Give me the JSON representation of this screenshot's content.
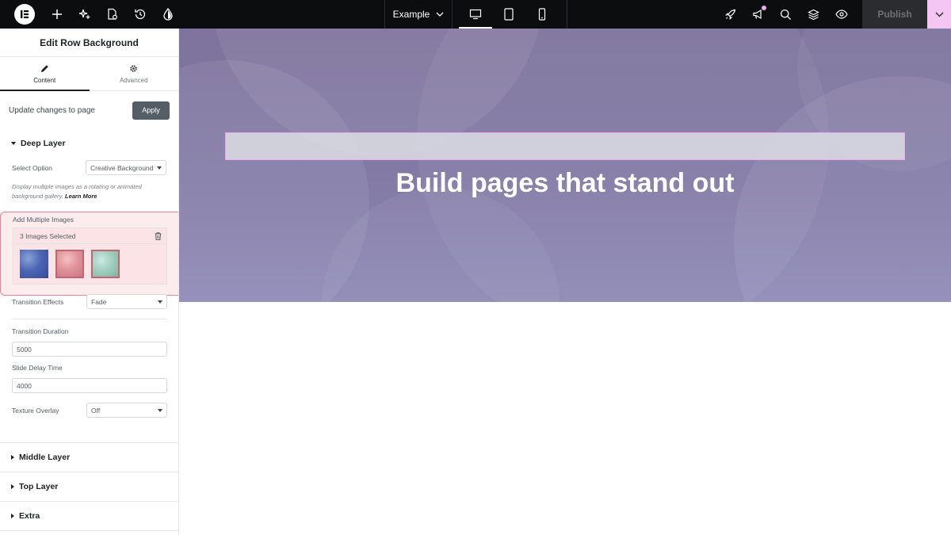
{
  "topbar": {
    "document_name": "Example",
    "publish_label": "Publish",
    "icons_left": [
      "elementor-logo-icon",
      "plus-icon",
      "sparkle-icon",
      "page-settings-icon",
      "history-icon",
      "theme-icon"
    ],
    "icons_right": [
      "rocket-icon",
      "megaphone-icon",
      "search-icon",
      "layers-icon",
      "eye-icon"
    ],
    "notification_color": "#f0a6f0"
  },
  "panel": {
    "title": "Edit Row Background",
    "tabs": [
      {
        "label": "Content",
        "icon": "pencil-icon",
        "active": true
      },
      {
        "label": "Advanced",
        "icon": "gear-icon",
        "active": false
      }
    ],
    "update_text": "Update changes to page",
    "apply_label": "Apply",
    "deep_layer": {
      "title": "Deep Layer",
      "select_option_label": "Select Option",
      "select_option_value": "Creative Background",
      "description": "Display multiple images as a rotating or animated background gallery.",
      "learn_more": "Learn More",
      "add_images_label": "Add Multiple Images",
      "images_selected": "3 Images Selected",
      "transition_effects_label": "Transition Effects",
      "transition_effects_value": "Fade",
      "transition_duration_label": "Transition Duration",
      "transition_duration_value": "5000",
      "slide_delay_label": "Slide Delay Time",
      "slide_delay_value": "4000",
      "texture_overlay_label": "Texture Overlay",
      "texture_overlay_value": "Off"
    },
    "sections": [
      "Middle Layer",
      "Top Layer",
      "Extra"
    ]
  },
  "canvas": {
    "headline": "Build pages that stand out"
  },
  "colors": {
    "highlight_border": "#f07f99",
    "guide_border": "#f1a6ef",
    "canvas_bg": "#837ba6"
  }
}
